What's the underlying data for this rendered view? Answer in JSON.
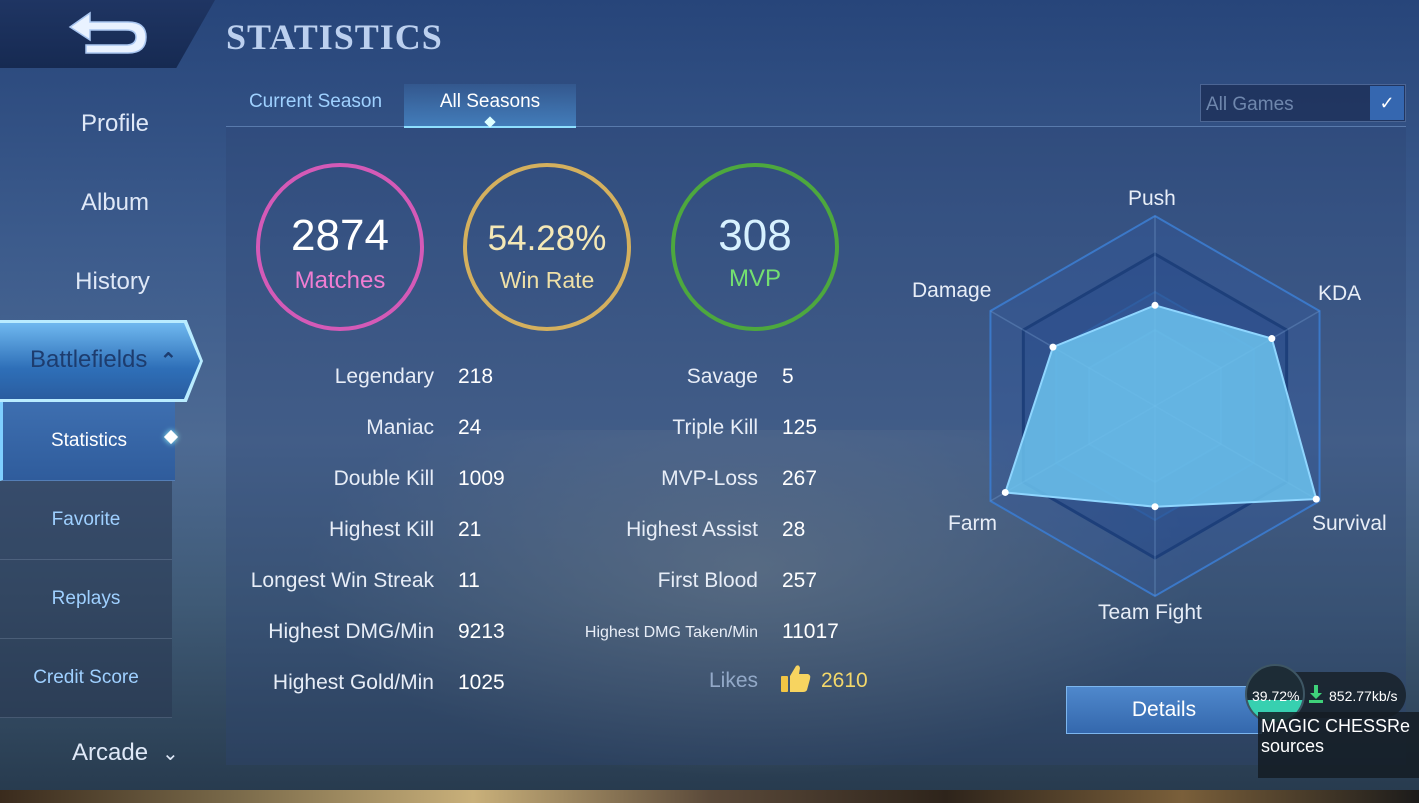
{
  "header": {
    "title": "STATISTICS",
    "back_icon": "back-arrow-icon"
  },
  "sidebar": {
    "items": [
      {
        "label": "Profile"
      },
      {
        "label": "Album"
      },
      {
        "label": "History"
      },
      {
        "label": "Battlefields",
        "expanded": true
      }
    ],
    "sub_items": [
      {
        "label": "Statistics",
        "active": true
      },
      {
        "label": "Favorite"
      },
      {
        "label": "Replays"
      },
      {
        "label": "Credit Score"
      }
    ],
    "arcade": {
      "label": "Arcade"
    }
  },
  "tabs": [
    {
      "label": "Current Season",
      "active": false
    },
    {
      "label": "All Seasons",
      "active": true
    }
  ],
  "games_filter": {
    "selected": "All Games"
  },
  "summary": {
    "matches": {
      "value": "2874",
      "label": "Matches",
      "color": "#d45ab7"
    },
    "win_rate": {
      "value": "54.28%",
      "label": "Win Rate",
      "color": "#d4b05e"
    },
    "mvp": {
      "value": "308",
      "label": "MVP",
      "color": "#4da83e"
    }
  },
  "stats_left": [
    {
      "label": "Legendary",
      "value": "218"
    },
    {
      "label": "Maniac",
      "value": "24"
    },
    {
      "label": "Double Kill",
      "value": "1009"
    },
    {
      "label": "Highest Kill",
      "value": "21"
    },
    {
      "label": "Longest Win Streak",
      "value": "11"
    },
    {
      "label": "Highest DMG/Min",
      "value": "9213"
    },
    {
      "label": "Highest Gold/Min",
      "value": "1025"
    }
  ],
  "stats_right": [
    {
      "label": "Savage",
      "value": "5"
    },
    {
      "label": "Triple Kill",
      "value": "125"
    },
    {
      "label": "MVP-Loss",
      "value": "267"
    },
    {
      "label": "Highest Assist",
      "value": "28"
    },
    {
      "label": "First Blood",
      "value": "257"
    },
    {
      "label": "Highest DMG Taken/Min",
      "value": "11017"
    }
  ],
  "likes": {
    "label": "Likes",
    "value": "2610",
    "icon": "thumbs-up-icon"
  },
  "radar": {
    "axes": [
      "Push",
      "KDA",
      "Survival",
      "Team Fight",
      "Farm",
      "Damage"
    ],
    "values": [
      0.53,
      0.71,
      0.98,
      0.53,
      0.91,
      0.62
    ],
    "fill_color": "#6cc3ee"
  },
  "details_button": {
    "label": "Details"
  },
  "overlay": {
    "percent": "39.72%",
    "speed": "852.77kb/s",
    "text": "MAGIC CHESSResources",
    "download_icon": "download-arrow-icon"
  }
}
